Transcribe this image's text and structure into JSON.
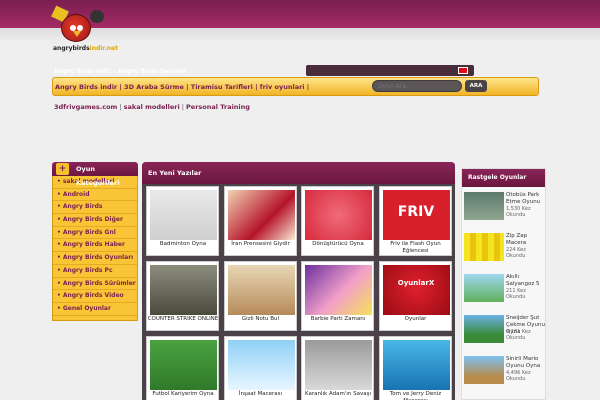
{
  "site": {
    "logo_text_a": "angrybirds",
    "logo_text_b": "indir.net",
    "tagline": "Angry Birds indir - Angry Birds Oyunlar"
  },
  "nav": {
    "links": [
      "Angry Birds indir",
      "3D Araba Sürme",
      "Tiramisu Tarifleri",
      "friv oyunlari"
    ],
    "separator": " | "
  },
  "search": {
    "placeholder": "Oyun Ara...",
    "button": "ARA"
  },
  "sublinks": {
    "items": [
      "3dfrivgames.com",
      "sakal modelleri",
      "Personal Training"
    ],
    "separator": " | "
  },
  "categories": {
    "title": "Oyun Kategorileri",
    "items": [
      "sakal modelleri",
      "Android",
      "Angry Birds",
      "Angry Birds Diğer",
      "Angry Birds Gnl",
      "Angry Birds Haber",
      "Angry Birds Oyunları",
      "Angry Birds Pc",
      "Angry Birds Sürümler",
      "Angry Birds Video",
      "Genel Oyunlar"
    ]
  },
  "main": {
    "title": "En Yeni Yazılar",
    "posts": [
      {
        "title": "Badminton Oyna",
        "thumb": "stickman-badminton"
      },
      {
        "title": "İran Prensesini Giydir",
        "thumb": "princess-dressup"
      },
      {
        "title": "Dönüştürücü Oyna",
        "thumb": "red-converter"
      },
      {
        "title": "Friv ile Flash Oyun Eğlencesi",
        "thumb": "friv-logo",
        "thumb_text": "FRIV"
      },
      {
        "title": "COUNTER STRIKE ONLINE",
        "thumb": "soldiers"
      },
      {
        "title": "Gizli Notu Bul",
        "thumb": "living-room"
      },
      {
        "title": "Barbie Parti Zamanı",
        "thumb": "barbie-party"
      },
      {
        "title": "Oyunlar",
        "thumb": "angry-face",
        "thumb_text": "OyunlarX"
      },
      {
        "title": "Futbol Kariyerim Oyna",
        "thumb": "football-field"
      },
      {
        "title": "İnşaat Macerası",
        "thumb": "construction-sky"
      },
      {
        "title": "Karanlık Adam'ın Savaşı",
        "thumb": "dark-city"
      },
      {
        "title": "Tom ve Jerry Deniz Macerası",
        "thumb": "sea-boat"
      }
    ]
  },
  "random": {
    "title": "Rastgele Oyunlar",
    "items": [
      {
        "title": "Otobüs Park Etme Oyunu",
        "count": "1,530 Kez Okundu",
        "thumb": "bus-park"
      },
      {
        "title": "Zip Zap Macera",
        "count": "224 Kez Okundu",
        "thumb": "yellow-grid"
      },
      {
        "title": "Akıllı Salyangoz 5",
        "count": "211 Kez Okundu",
        "thumb": "snail"
      },
      {
        "title": "Sneijder Şut Çekme Oyunu Oyna",
        "count": "4,131 Kez Okundu",
        "thumb": "goal"
      },
      {
        "title": "Sinirli Mario Oyunu Oyna",
        "count": "4,496 Kez Okundu",
        "thumb": "mario"
      }
    ]
  },
  "colors": {
    "brand": "#7a1f4f",
    "accent": "#f2b426",
    "panel": "#4a4248"
  }
}
